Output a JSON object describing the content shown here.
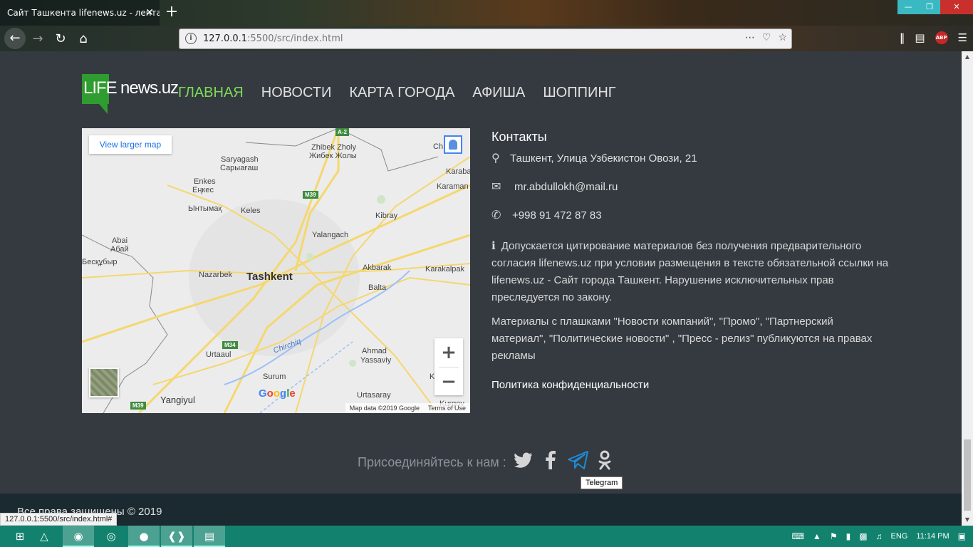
{
  "browser": {
    "tab_title": "Сайт Ташкента lifenews.uz - лента",
    "tab_close": "✕",
    "new_tab": "+",
    "url_host": "127.0.0.1",
    "url_rest": ":5500/src/index.html",
    "window_buttons": [
      "—",
      "❐",
      "✕"
    ]
  },
  "site": {
    "logo_life": "LIFE",
    "logo_news": "news.uz",
    "menu": [
      {
        "label": "ГЛАВНАЯ",
        "active": true
      },
      {
        "label": "НОВОСТИ"
      },
      {
        "label": "КАРТА ГОРОДА"
      },
      {
        "label": "АФИША"
      },
      {
        "label": "ШОППИНГ"
      }
    ]
  },
  "map": {
    "larger_map": "View larger map",
    "city": "Tashkent",
    "labels": [
      "Zhibek Zholy",
      "Жибек Жолы",
      "Saryagash",
      "Сарыағаш",
      "Enkes",
      "Еңкес",
      "Ынтымақ",
      "Keles",
      "Kibray",
      "Yalangach",
      "Abai",
      "Абай",
      "Бесқұбыр",
      "Nazarbek",
      "Akbarak",
      "Karakalpak",
      "Balta",
      "Urtaaul",
      "Ahmad",
      "Yassaviy",
      "Surum",
      "Yangiyul",
      "Urtasaray",
      "Karaba",
      "Karaman",
      "Ch",
      "K",
      "Kurgov"
    ],
    "river": "Chirchiq",
    "shields": [
      "A-2",
      "M39",
      "M34",
      "M39"
    ],
    "google": [
      "G",
      "o",
      "o",
      "g",
      "l",
      "e"
    ],
    "data_credit": "Map data ©2019 Google",
    "terms": "Terms of Use",
    "zoom_in": "+",
    "zoom_out": "−"
  },
  "contacts": {
    "title": "Контакты",
    "address": "Ташкент, Улица Узбекистон Овози, 21",
    "email": "mr.abdullokh@mail.ru",
    "phone": "+998 91 472 87 83",
    "notice_icon": "i",
    "notice": "Допускается цитирование материалов без получения предварительного согласия lifenews.uz при условии размещения в тексте обязательной ссылки на lifenews.uz - Сайт города Ташкент. Нарушение исключительных прав преследуется по закону.",
    "ads": "Материалы с плашками \"Новости компаний\", \"Промо\", \"Партнерский материал\", \"Политические новости\" , \"Пресс - релиз\" публикуются на правах рекламы",
    "policy": "Политика конфиденциальности"
  },
  "join": {
    "text": "Присоединяйтесь к нам :",
    "tooltip": "Telegram"
  },
  "footer": {
    "copyright": "Все права защищены © 2019",
    "status_url": "127.0.0.1:5500/src/index.html#"
  },
  "taskbar": {
    "lang": "ENG",
    "time": "11:14 PM"
  },
  "colors": {
    "accent_green": "#7ed957",
    "page_bg": "#343a40",
    "telegram_blue": "#1e8bd6",
    "taskbar": "#12826e"
  }
}
